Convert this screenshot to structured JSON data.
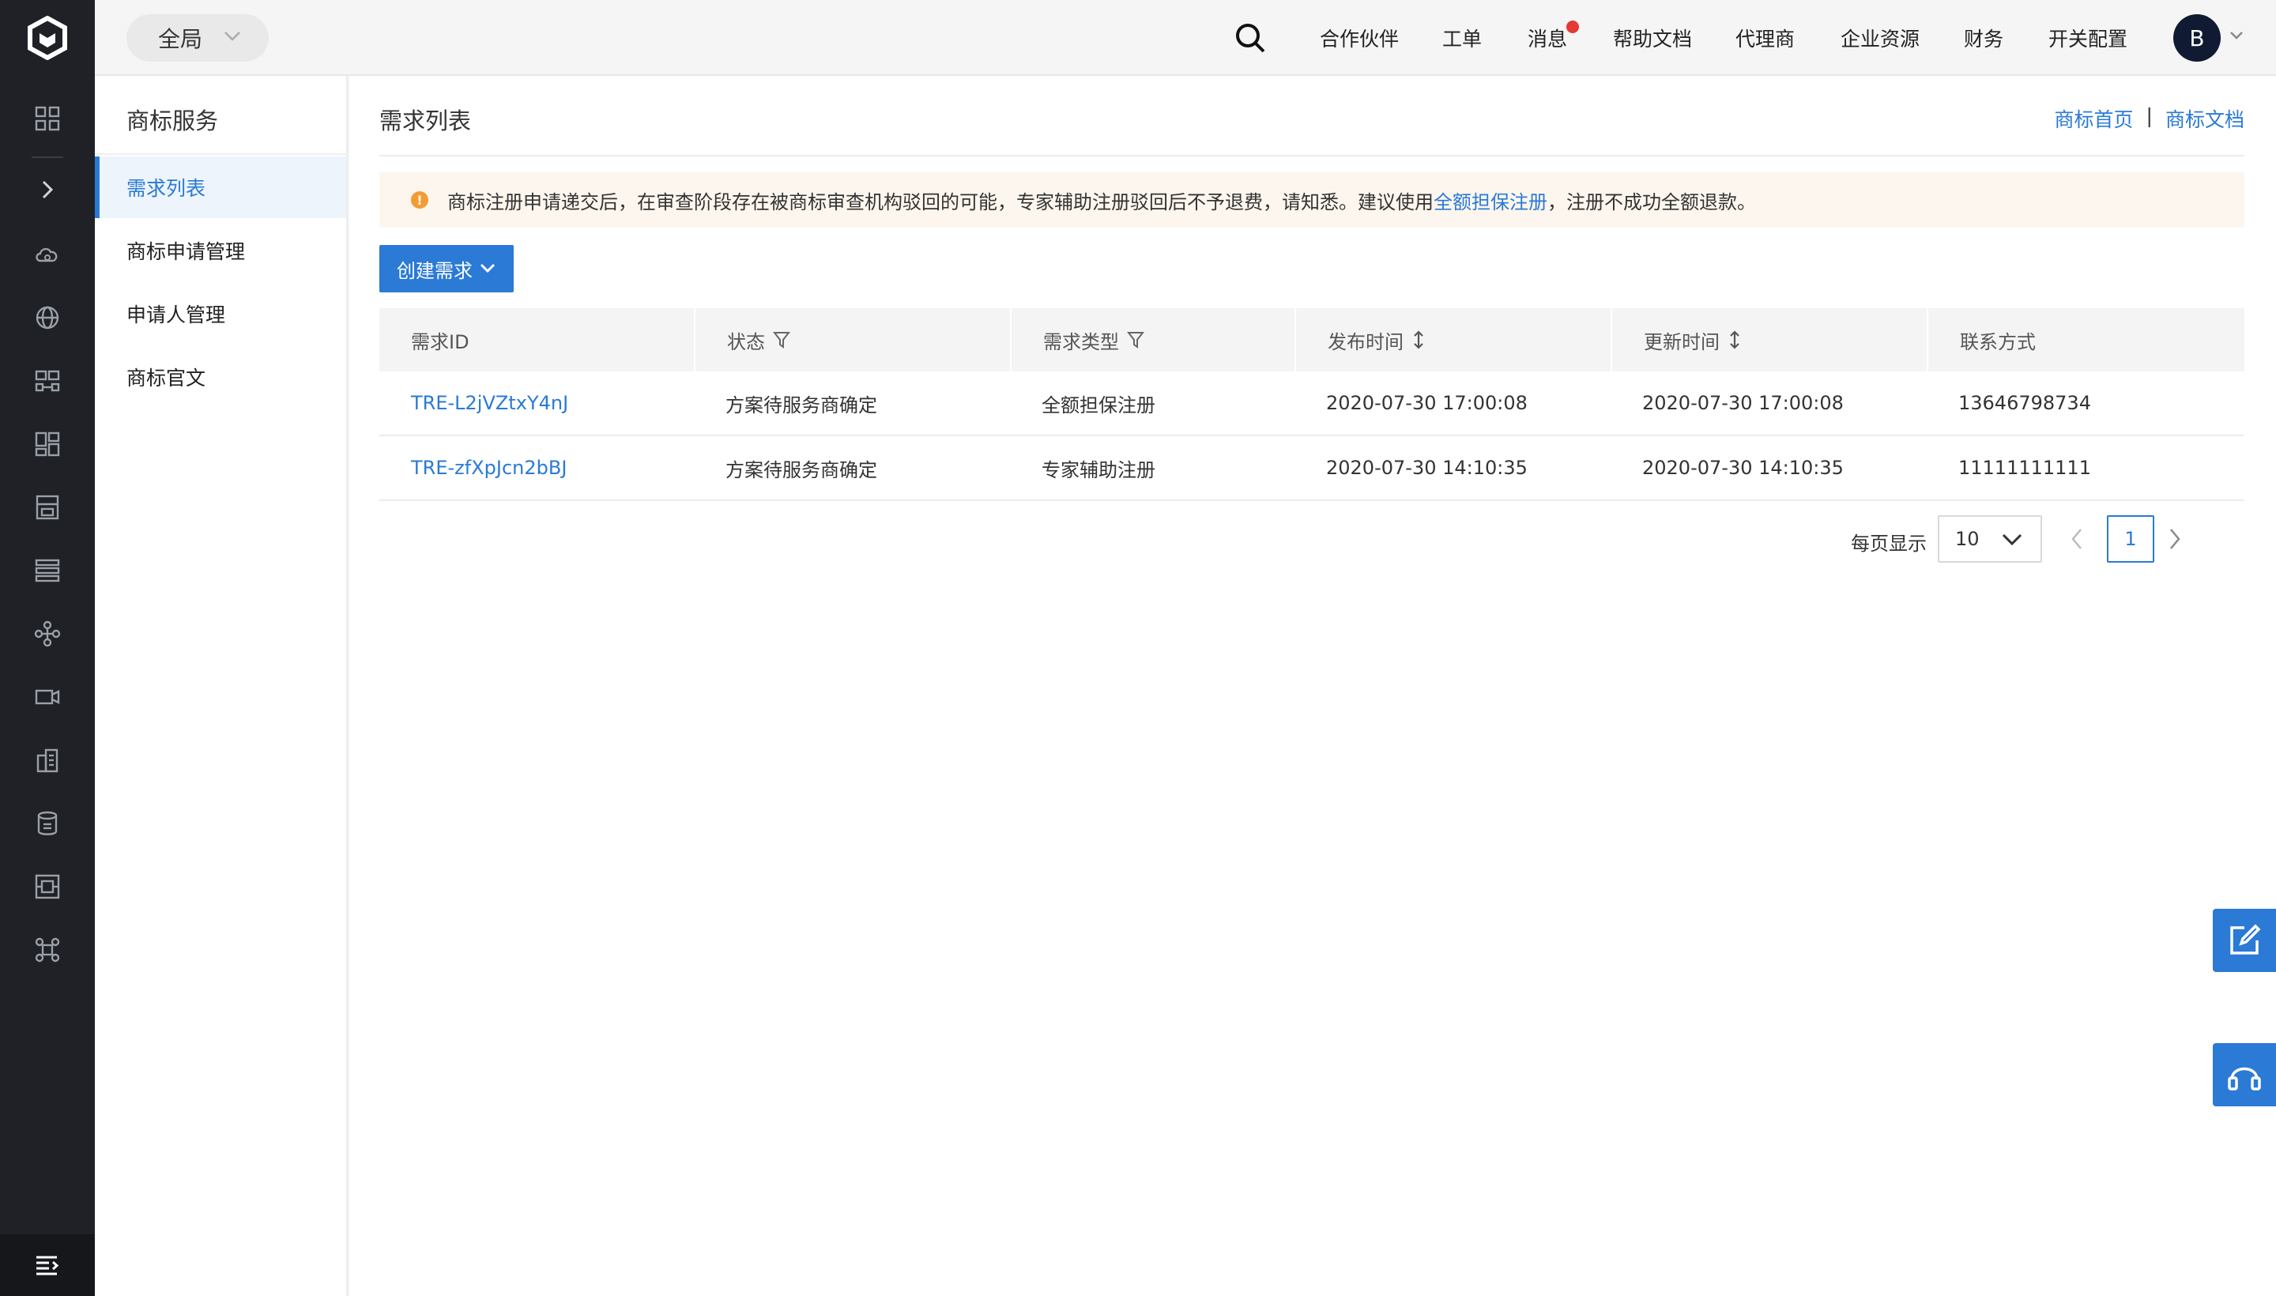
{
  "topbar": {
    "scope_label": "全局",
    "nav": [
      "合作伙伴",
      "工单",
      "消息",
      "帮助文档",
      "代理商",
      "企业资源",
      "财务",
      "开关配置"
    ],
    "avatar_initial": "B"
  },
  "subnav": {
    "title": "商标服务",
    "items": [
      "需求列表",
      "商标申请管理",
      "申请人管理",
      "商标官文"
    ],
    "active_index": 0
  },
  "main": {
    "title": "需求列表",
    "breadcrumb": {
      "home": "商标首页",
      "separator": "|",
      "docs": "商标文档"
    },
    "notice": {
      "text_before": "商标注册申请递交后，在审查阶段存在被商标审查机构驳回的可能，专家辅助注册驳回后不予退费，请知悉。建议使用 ",
      "link": "全额担保注册",
      "text_after": "，注册不成功全额退款。"
    },
    "create_button": "创建需求",
    "table": {
      "headers": [
        "需求ID",
        "状态",
        "需求类型",
        "发布时间",
        "更新时间",
        "联系方式"
      ],
      "rows": [
        [
          "TRE-L2jVZtxY4nJ",
          "方案待服务商确定",
          "全额担保注册",
          "2020-07-30 17:00:08",
          "2020-07-30 17:00:08",
          "13646798734"
        ],
        [
          "TRE-zfXpJcn2bBJ",
          "方案待服务商确定",
          "专家辅助注册",
          "2020-07-30 14:10:35",
          "2020-07-30 14:10:35",
          "11111111111"
        ]
      ]
    },
    "pagination": {
      "page_size_label": "每页显示",
      "page_size": "10",
      "current_page": "1"
    }
  },
  "colors": {
    "accent": "#2a7ad6",
    "rail": "#1f2126",
    "warning": "#f39c34",
    "badge": "#e53935"
  }
}
